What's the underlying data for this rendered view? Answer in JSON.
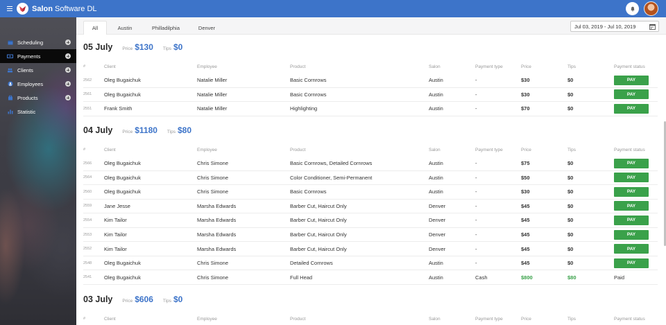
{
  "app": {
    "title_bold": "Salon",
    "title_rest": " Software DL"
  },
  "colors": {
    "accent": "#3d74c9",
    "pay": "#3aa14a",
    "paid_value": "#3aa14a"
  },
  "sidebar": {
    "items": [
      {
        "label": "Scheduling",
        "icon": "calendar-icon"
      },
      {
        "label": "Payments",
        "icon": "payments-icon",
        "active": true
      },
      {
        "label": "Clients",
        "icon": "clients-icon"
      },
      {
        "label": "Employees",
        "icon": "employees-icon"
      },
      {
        "label": "Products",
        "icon": "products-icon"
      },
      {
        "label": "Statistic",
        "icon": "chart-icon"
      }
    ]
  },
  "tabs": [
    "All",
    "Austin",
    "Philladilphia",
    "Denver"
  ],
  "date_range": "Jul 03, 2019 - Jul 10, 2019",
  "columns": [
    "#",
    "Client",
    "Employee",
    "Product",
    "Salon",
    "Payment type",
    "Price",
    "Tips",
    "Payment status"
  ],
  "days": [
    {
      "title": "05 July",
      "price_label": "Price",
      "price": "$130",
      "tips_label": "Tips",
      "tips": "$0",
      "rows": [
        [
          "2562",
          "Oleg Bugaichuk",
          "Natalie Miller",
          "Basic Cornrows",
          "Austin",
          "-",
          "$30",
          "$0",
          "PAY"
        ],
        [
          "2561",
          "Oleg Bugaichuk",
          "Natalie Miller",
          "Basic Cornrows",
          "Austin",
          "-",
          "$30",
          "$0",
          "PAY"
        ],
        [
          "2551",
          "Frank Smith",
          "Natalie Miller",
          "Highlighting",
          "Austin",
          "-",
          "$70",
          "$0",
          "PAY"
        ]
      ]
    },
    {
      "title": "04 July",
      "price_label": "Price",
      "price": "$1180",
      "tips_label": "Tips",
      "tips": "$80",
      "rows": [
        [
          "2566",
          "Oleg Bugaichuk",
          "Chris Simone",
          "Basic Cornrows, Detailed Cornrows",
          "Austin",
          "-",
          "$75",
          "$0",
          "PAY"
        ],
        [
          "2564",
          "Oleg Bugaichuk",
          "Chris Simone",
          "Color Conditioner, Semi-Permanent",
          "Austin",
          "-",
          "$50",
          "$0",
          "PAY"
        ],
        [
          "2560",
          "Oleg Bugaichuk",
          "Chris Simone",
          "Basic Cornrows",
          "Austin",
          "-",
          "$30",
          "$0",
          "PAY"
        ],
        [
          "2559",
          "Jane Jesse",
          "Marsha Edwards",
          "Barber Cut, Haircut Only",
          "Denver",
          "-",
          "$45",
          "$0",
          "PAY"
        ],
        [
          "2554",
          "Kim Tailor",
          "Marsha Edwards",
          "Barber Cut, Haircut Only",
          "Denver",
          "-",
          "$45",
          "$0",
          "PAY"
        ],
        [
          "2553",
          "Kim Tailor",
          "Marsha Edwards",
          "Barber Cut, Haircut Only",
          "Denver",
          "-",
          "$45",
          "$0",
          "PAY"
        ],
        [
          "2552",
          "Kim Tailor",
          "Marsha Edwards",
          "Barber Cut, Haircut Only",
          "Denver",
          "-",
          "$45",
          "$0",
          "PAY"
        ],
        [
          "2548",
          "Oleg Bugaichuk",
          "Chris Simone",
          "Detailed Cornrows",
          "Austin",
          "-",
          "$45",
          "$0",
          "PAY"
        ],
        [
          "2541",
          "Oleg Bugaichuk",
          "Chris Simone",
          "Full Head",
          "Austin",
          "Cash",
          "$800",
          "$80",
          "Paid"
        ]
      ]
    },
    {
      "title": "03 July",
      "price_label": "Price",
      "price": "$606",
      "tips_label": "Tips",
      "tips": "$0",
      "rows": []
    }
  ]
}
